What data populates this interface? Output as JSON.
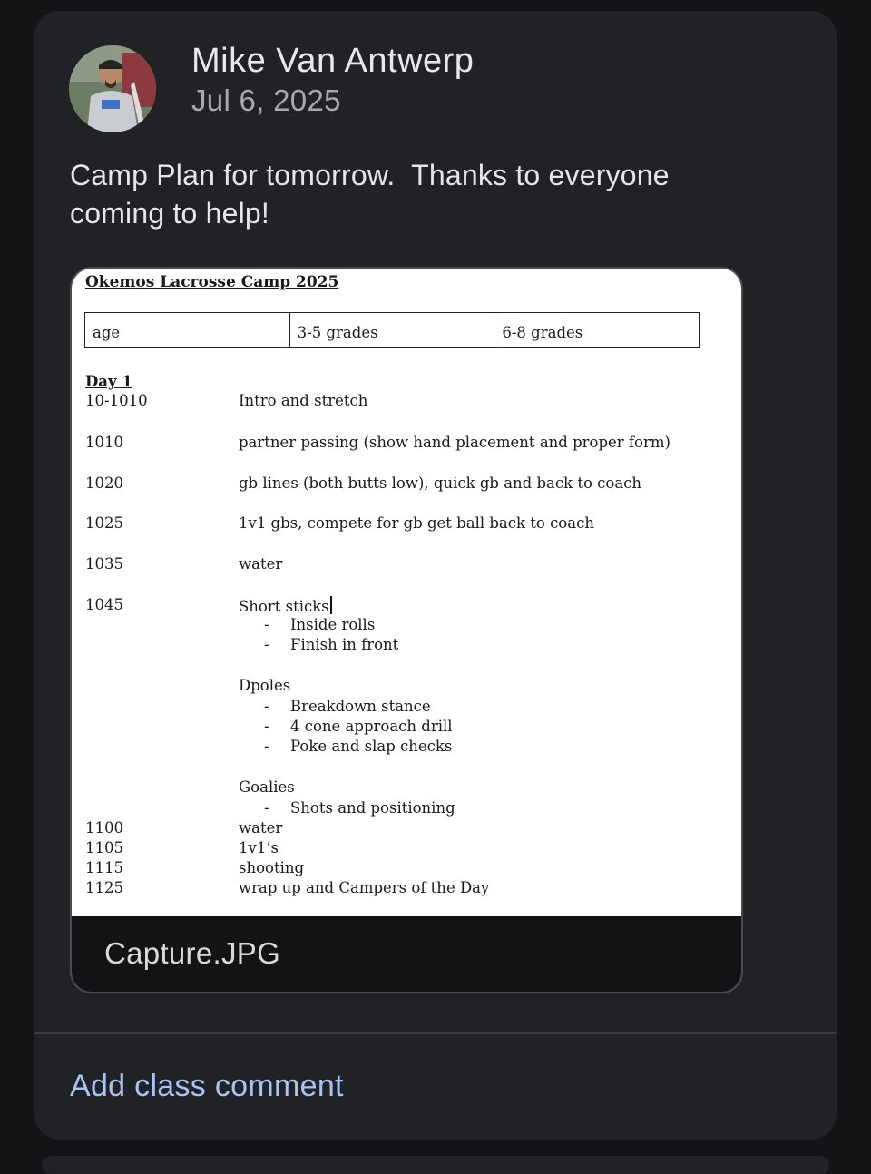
{
  "post": {
    "author": "Mike Van Antwerp",
    "date": "Jul 6, 2025",
    "text": "Camp Plan for tomorrow.  Thanks to everyone\ncoming to help!"
  },
  "attachment": {
    "file_name": "Capture.JPG",
    "document": {
      "title": "Okemos Lacrosse Camp 2025",
      "table": [
        "age",
        "3-5 grades",
        "6-8 grades"
      ],
      "day": "Day 1",
      "schedule": [
        {
          "time": "10-1010",
          "activity": "Intro and stretch"
        },
        {
          "time": "1010",
          "activity": "partner passing (show hand placement and proper form)"
        },
        {
          "time": "1020",
          "activity": "gb lines (both butts low), quick gb and back to coach"
        },
        {
          "time": "1025",
          "activity": "1v1 gbs, compete for gb get ball back to coach"
        },
        {
          "time": "1035",
          "activity": "water"
        },
        {
          "time": "1045",
          "activity": "Short sticks"
        }
      ],
      "groups": {
        "short_sticks": [
          "Inside rolls",
          "Finish in front"
        ],
        "dpoles_label": "Dpoles",
        "dpoles": [
          "Breakdown stance",
          "4 cone approach drill",
          "Poke and slap checks"
        ],
        "goalies_label": "Goalies",
        "goalies": [
          "Shots and positioning"
        ]
      },
      "bullet": "-",
      "late_schedule": [
        {
          "time": "1100",
          "activity": "water"
        },
        {
          "time": "1105",
          "activity": "1v1’s"
        },
        {
          "time": "1115",
          "activity": "shooting"
        },
        {
          "time": "1125",
          "activity": "wrap up and Campers of the Day"
        }
      ]
    }
  },
  "comment_link": "Add class comment",
  "icons": {
    "avatar": "profile-photo"
  }
}
